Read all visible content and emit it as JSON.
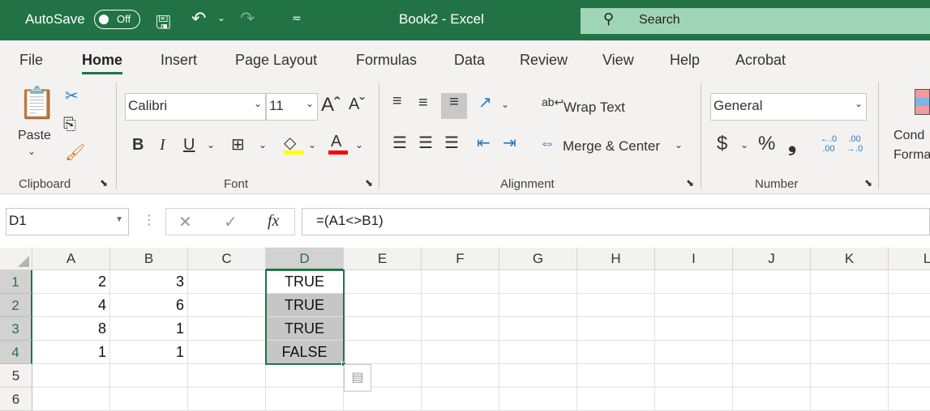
{
  "titlebar": {
    "autosave": "AutoSave",
    "toggle": "Off",
    "title": "Book2  -  Excel",
    "search": "Search"
  },
  "tabs": [
    "File",
    "Home",
    "Insert",
    "Page Layout",
    "Formulas",
    "Data",
    "Review",
    "View",
    "Help",
    "Acrobat"
  ],
  "active_tab": "Home",
  "ribbon": {
    "clipboard": {
      "paste": "Paste",
      "label": "Clipboard"
    },
    "font": {
      "name": "Calibri",
      "size": "11",
      "label": "Font",
      "bold": "B",
      "italic": "I",
      "underline": "U",
      "fill_color": "#ffff00",
      "font_color": "#ff0000"
    },
    "alignment": {
      "wrap": "Wrap Text",
      "merge": "Merge & Center",
      "label": "Alignment"
    },
    "number": {
      "format": "General",
      "currency": "$",
      "percent": "%",
      "comma": "❟",
      "inc_decimal": "←.0 .00",
      "dec_decimal": ".00 →.0",
      "label": "Number"
    },
    "styles": {
      "cond_format": "Cond Forma"
    }
  },
  "formula_bar": {
    "name_box": "D1",
    "cancel": "✕",
    "enter": "✓",
    "fx": "fx",
    "formula": "=(A1<>B1)"
  },
  "columns": [
    "A",
    "B",
    "C",
    "D",
    "E",
    "F",
    "G",
    "H",
    "I",
    "J",
    "K",
    "L"
  ],
  "rows": [
    "1",
    "2",
    "3",
    "4",
    "5",
    "6"
  ],
  "cells": [
    [
      "2",
      "3",
      "",
      "TRUE"
    ],
    [
      "4",
      "6",
      "",
      "TRUE"
    ],
    [
      "8",
      "1",
      "",
      "TRUE"
    ],
    [
      "1",
      "1",
      "",
      "FALSE"
    ]
  ],
  "selection": "D1:D4",
  "accent": "#217346"
}
